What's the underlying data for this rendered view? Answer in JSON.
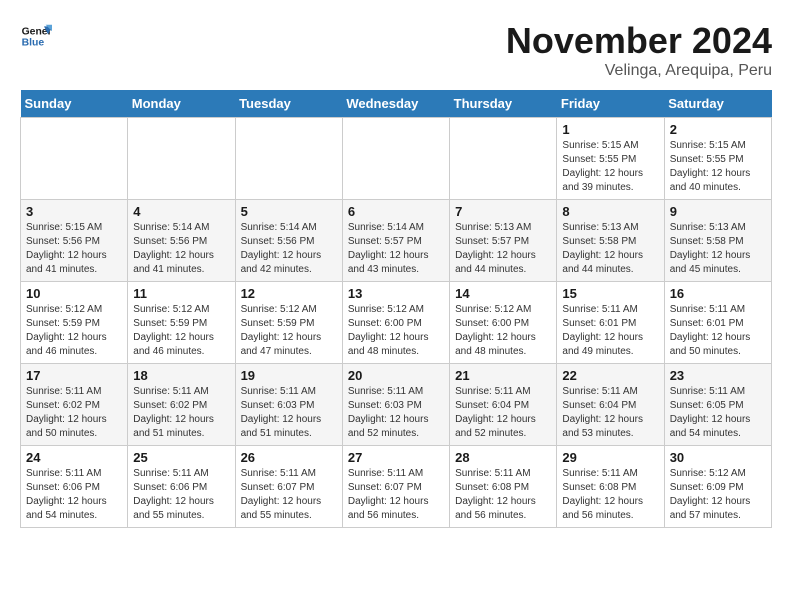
{
  "header": {
    "logo_line1": "General",
    "logo_line2": "Blue",
    "month": "November 2024",
    "location": "Velinga, Arequipa, Peru"
  },
  "weekdays": [
    "Sunday",
    "Monday",
    "Tuesday",
    "Wednesday",
    "Thursday",
    "Friday",
    "Saturday"
  ],
  "weeks": [
    [
      {
        "day": "",
        "info": ""
      },
      {
        "day": "",
        "info": ""
      },
      {
        "day": "",
        "info": ""
      },
      {
        "day": "",
        "info": ""
      },
      {
        "day": "",
        "info": ""
      },
      {
        "day": "1",
        "info": "Sunrise: 5:15 AM\nSunset: 5:55 PM\nDaylight: 12 hours and 39 minutes."
      },
      {
        "day": "2",
        "info": "Sunrise: 5:15 AM\nSunset: 5:55 PM\nDaylight: 12 hours and 40 minutes."
      }
    ],
    [
      {
        "day": "3",
        "info": "Sunrise: 5:15 AM\nSunset: 5:56 PM\nDaylight: 12 hours and 41 minutes."
      },
      {
        "day": "4",
        "info": "Sunrise: 5:14 AM\nSunset: 5:56 PM\nDaylight: 12 hours and 41 minutes."
      },
      {
        "day": "5",
        "info": "Sunrise: 5:14 AM\nSunset: 5:56 PM\nDaylight: 12 hours and 42 minutes."
      },
      {
        "day": "6",
        "info": "Sunrise: 5:14 AM\nSunset: 5:57 PM\nDaylight: 12 hours and 43 minutes."
      },
      {
        "day": "7",
        "info": "Sunrise: 5:13 AM\nSunset: 5:57 PM\nDaylight: 12 hours and 44 minutes."
      },
      {
        "day": "8",
        "info": "Sunrise: 5:13 AM\nSunset: 5:58 PM\nDaylight: 12 hours and 44 minutes."
      },
      {
        "day": "9",
        "info": "Sunrise: 5:13 AM\nSunset: 5:58 PM\nDaylight: 12 hours and 45 minutes."
      }
    ],
    [
      {
        "day": "10",
        "info": "Sunrise: 5:12 AM\nSunset: 5:59 PM\nDaylight: 12 hours and 46 minutes."
      },
      {
        "day": "11",
        "info": "Sunrise: 5:12 AM\nSunset: 5:59 PM\nDaylight: 12 hours and 46 minutes."
      },
      {
        "day": "12",
        "info": "Sunrise: 5:12 AM\nSunset: 5:59 PM\nDaylight: 12 hours and 47 minutes."
      },
      {
        "day": "13",
        "info": "Sunrise: 5:12 AM\nSunset: 6:00 PM\nDaylight: 12 hours and 48 minutes."
      },
      {
        "day": "14",
        "info": "Sunrise: 5:12 AM\nSunset: 6:00 PM\nDaylight: 12 hours and 48 minutes."
      },
      {
        "day": "15",
        "info": "Sunrise: 5:11 AM\nSunset: 6:01 PM\nDaylight: 12 hours and 49 minutes."
      },
      {
        "day": "16",
        "info": "Sunrise: 5:11 AM\nSunset: 6:01 PM\nDaylight: 12 hours and 50 minutes."
      }
    ],
    [
      {
        "day": "17",
        "info": "Sunrise: 5:11 AM\nSunset: 6:02 PM\nDaylight: 12 hours and 50 minutes."
      },
      {
        "day": "18",
        "info": "Sunrise: 5:11 AM\nSunset: 6:02 PM\nDaylight: 12 hours and 51 minutes."
      },
      {
        "day": "19",
        "info": "Sunrise: 5:11 AM\nSunset: 6:03 PM\nDaylight: 12 hours and 51 minutes."
      },
      {
        "day": "20",
        "info": "Sunrise: 5:11 AM\nSunset: 6:03 PM\nDaylight: 12 hours and 52 minutes."
      },
      {
        "day": "21",
        "info": "Sunrise: 5:11 AM\nSunset: 6:04 PM\nDaylight: 12 hours and 52 minutes."
      },
      {
        "day": "22",
        "info": "Sunrise: 5:11 AM\nSunset: 6:04 PM\nDaylight: 12 hours and 53 minutes."
      },
      {
        "day": "23",
        "info": "Sunrise: 5:11 AM\nSunset: 6:05 PM\nDaylight: 12 hours and 54 minutes."
      }
    ],
    [
      {
        "day": "24",
        "info": "Sunrise: 5:11 AM\nSunset: 6:06 PM\nDaylight: 12 hours and 54 minutes."
      },
      {
        "day": "25",
        "info": "Sunrise: 5:11 AM\nSunset: 6:06 PM\nDaylight: 12 hours and 55 minutes."
      },
      {
        "day": "26",
        "info": "Sunrise: 5:11 AM\nSunset: 6:07 PM\nDaylight: 12 hours and 55 minutes."
      },
      {
        "day": "27",
        "info": "Sunrise: 5:11 AM\nSunset: 6:07 PM\nDaylight: 12 hours and 56 minutes."
      },
      {
        "day": "28",
        "info": "Sunrise: 5:11 AM\nSunset: 6:08 PM\nDaylight: 12 hours and 56 minutes."
      },
      {
        "day": "29",
        "info": "Sunrise: 5:11 AM\nSunset: 6:08 PM\nDaylight: 12 hours and 56 minutes."
      },
      {
        "day": "30",
        "info": "Sunrise: 5:12 AM\nSunset: 6:09 PM\nDaylight: 12 hours and 57 minutes."
      }
    ]
  ]
}
